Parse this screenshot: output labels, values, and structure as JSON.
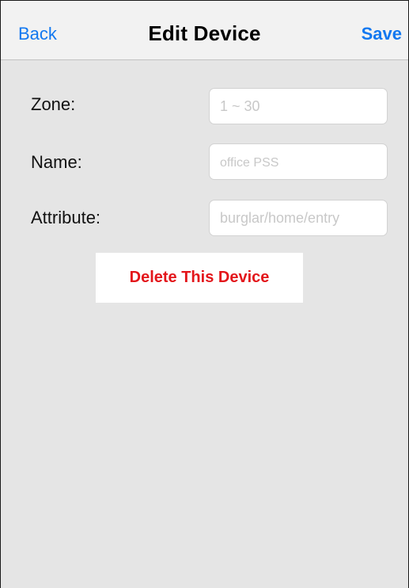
{
  "navbar": {
    "back_label": "Back",
    "title": "Edit Device",
    "save_label": "Save"
  },
  "form": {
    "zone": {
      "label": "Zone:",
      "value": "",
      "placeholder": "1 ~ 30"
    },
    "name": {
      "label": "Name:",
      "value": "",
      "placeholder": "office PSS"
    },
    "attribute": {
      "label": "Attribute:",
      "value": "",
      "placeholder": "burglar/home/entry"
    }
  },
  "delete_button_label": "Delete This Device",
  "colors": {
    "accent": "#1278f0",
    "destructive": "#e3161b",
    "background": "#e5e5e5",
    "navbar": "#f2f2f2"
  }
}
